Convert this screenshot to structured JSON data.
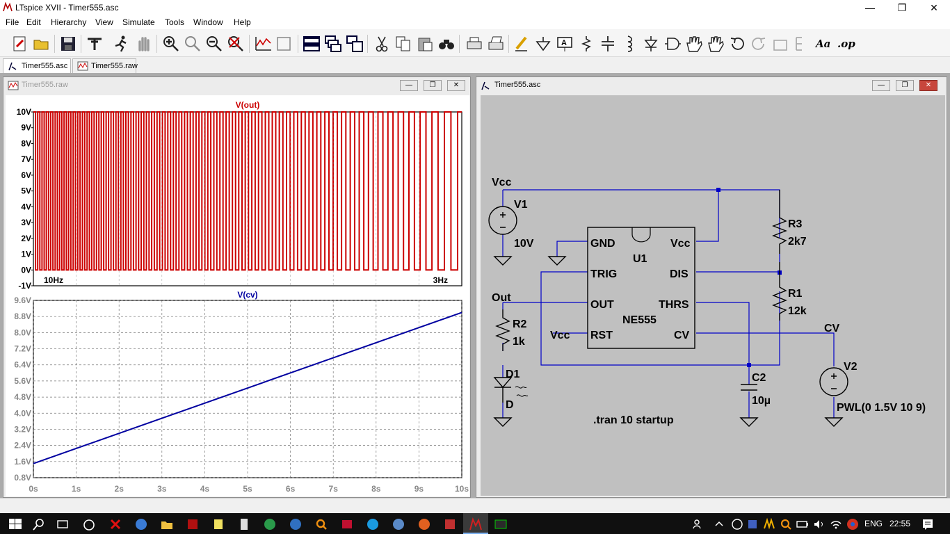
{
  "window": {
    "title": "LTspice XVII - Timer555.asc"
  },
  "menu": [
    "File",
    "Edit",
    "Hierarchy",
    "View",
    "Simulate",
    "Tools",
    "Window",
    "Help"
  ],
  "toolbar_icons": [
    "new-schematic-icon",
    "open-icon",
    "save-icon",
    "control-panel-icon",
    "run-icon",
    "halt-icon",
    "zoom-in-icon",
    "zoom-pan-icon",
    "zoom-out-icon",
    "zoom-fit-icon",
    "autorange-icon",
    "fullscreen-icon",
    "tile-horizontal-icon",
    "cascade-icon",
    "tile-vertical-icon",
    "cut-icon",
    "copy-icon",
    "paste-icon",
    "find-icon",
    "print-icon",
    "print-setup-icon",
    "draw-wire-icon",
    "ground-icon",
    "label-net-icon",
    "resistor-icon",
    "capacitor-icon",
    "inductor-icon",
    "diode-icon",
    "component-icon",
    "move-icon",
    "drag-icon",
    "undo-icon",
    "redo-icon",
    "rotate-icon",
    "mirror-icon"
  ],
  "toolbar_text": {
    "text_tool": "Aa",
    "spice_directive": ".op"
  },
  "tabs": [
    {
      "label": "Timer555.asc",
      "icon": "schematic-icon",
      "active": true
    },
    {
      "label": "Timer555.raw",
      "icon": "waveform-icon",
      "active": false
    }
  ],
  "waveform_window": {
    "title": "Timer555.raw",
    "buttons": [
      "minimize",
      "restore",
      "close"
    ]
  },
  "schematic_window": {
    "title": "Timer555.asc",
    "buttons": [
      "minimize",
      "restore",
      "close"
    ]
  },
  "chart_data": [
    {
      "type": "line",
      "title": "V(out)",
      "color": "#cc0000",
      "ylim": [
        -1,
        10
      ],
      "y_ticks": [
        "10V",
        "9V",
        "8V",
        "7V",
        "6V",
        "5V",
        "4V",
        "3V",
        "2V",
        "1V",
        "0V",
        "-1V"
      ],
      "annotations": [
        "10Hz",
        "3Hz"
      ],
      "series": [
        {
          "name": "V(out)",
          "low": 0,
          "high": 10,
          "shape": "square wave, frequency decreasing from 10Hz to 3Hz over 0s to 10s"
        }
      ],
      "grid": true
    },
    {
      "type": "line",
      "title": "V(cv)",
      "color": "#0000a0",
      "ylim": [
        0.8,
        9.6
      ],
      "y_ticks": [
        "9.6V",
        "8.8V",
        "8.0V",
        "7.2V",
        "6.4V",
        "5.6V",
        "4.8V",
        "4.0V",
        "3.2V",
        "2.4V",
        "1.6V",
        "0.8V"
      ],
      "x_ticks": [
        "0s",
        "1s",
        "2s",
        "3s",
        "4s",
        "5s",
        "6s",
        "7s",
        "8s",
        "9s",
        "10s"
      ],
      "xlim": [
        0,
        10
      ],
      "series": [
        {
          "name": "V(cv)",
          "x": [
            0,
            10
          ],
          "y": [
            1.5,
            9.0
          ]
        }
      ],
      "grid": true
    }
  ],
  "schematic": {
    "labels": {
      "vcc_top": "Vcc",
      "v1": "V1",
      "v1_val": "10V",
      "gnd_pin": "GND",
      "u1": "U1",
      "vcc_pin": "Vcc",
      "trig": "TRIG",
      "dis": "DIS",
      "out_pin": "OUT",
      "thrs": "THRS",
      "rst": "RST",
      "cv_pin": "CV",
      "ne555": "NE555",
      "r3": "R3",
      "r3_val": "2k7",
      "r1": "R1",
      "r1_val": "12k",
      "out_net": "Out",
      "r2": "R2",
      "r2_val": "1k",
      "vcc_rst": "Vcc",
      "d1": "D1",
      "d_val": "D",
      "cv_net": "CV",
      "v2": "V2",
      "v2_val": "PWL(0 1.5V 10 9)",
      "c2": "C2",
      "c2_val": "10µ",
      "directive": ".tran 10 startup"
    },
    "wire_color": "#0000c8"
  },
  "taskbar": {
    "language": "ENG",
    "time": "22:55"
  }
}
